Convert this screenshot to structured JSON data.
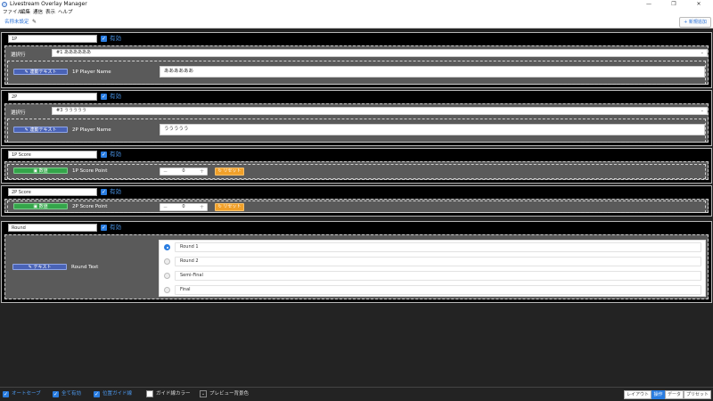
{
  "window": {
    "title": "Livestream Overlay Manager",
    "min": "—",
    "max": "❐",
    "close": "✕"
  },
  "menu": [
    "ファイル",
    "編集",
    "通信",
    "表示",
    "ヘルプ"
  ],
  "toolbar": {
    "doc_tab": "名称未設定",
    "edit_icon": "✎",
    "add_label": "新規追加",
    "add_icon": "+"
  },
  "panels": [
    {
      "name": "1P",
      "enabled": "有効",
      "select_label": "選択行",
      "select_value": "#1 ああああああ",
      "mode": "連動テキスト",
      "mode_icon": "✎",
      "field_label": "1P Player Name",
      "field_value": "ああああああ"
    },
    {
      "name": "2P",
      "enabled": "有効",
      "select_label": "選択行",
      "select_value": "#3 ううううう",
      "mode": "連動テキスト",
      "mode_icon": "✎",
      "field_label": "2P Player Name",
      "field_value": "ううううう"
    },
    {
      "name": "1P Score",
      "enabled": "有効",
      "mode": "数値",
      "mode_icon": "▣",
      "field_label": "1P Score Point",
      "value": "0",
      "minus": "−",
      "plus": "+",
      "reset": "リセット",
      "reset_icon": "↻"
    },
    {
      "name": "2P Score",
      "enabled": "有効",
      "mode": "数値",
      "mode_icon": "▣",
      "field_label": "2P Score Point",
      "value": "0",
      "minus": "−",
      "plus": "+",
      "reset": "リセット",
      "reset_icon": "↻"
    },
    {
      "name": "Round",
      "enabled": "有効",
      "mode": "テキスト",
      "mode_icon": "✎",
      "field_label": "Round Text",
      "rounds": [
        "Round 1",
        "Round 2",
        "Semi-Final",
        "Final"
      ],
      "selected_round": 0
    }
  ],
  "footer": {
    "autosave": "オートセーブ",
    "all_enabled": "全て有効",
    "position_guide": "位置ガイド線",
    "guide_color": "ガイド線カラー",
    "preview_bg": "プレビュー背景色",
    "tabs": [
      "レイアウト",
      "操作",
      "データ",
      "プリセット"
    ],
    "active_tab": 1
  },
  "colors": {
    "accent": "#2a7de1",
    "panel_bg": "#000000",
    "body_bg": "#5a5a5a",
    "reset": "#f0a02a",
    "number_btn": "#34a54a",
    "text_btn": "#4a63b6"
  }
}
